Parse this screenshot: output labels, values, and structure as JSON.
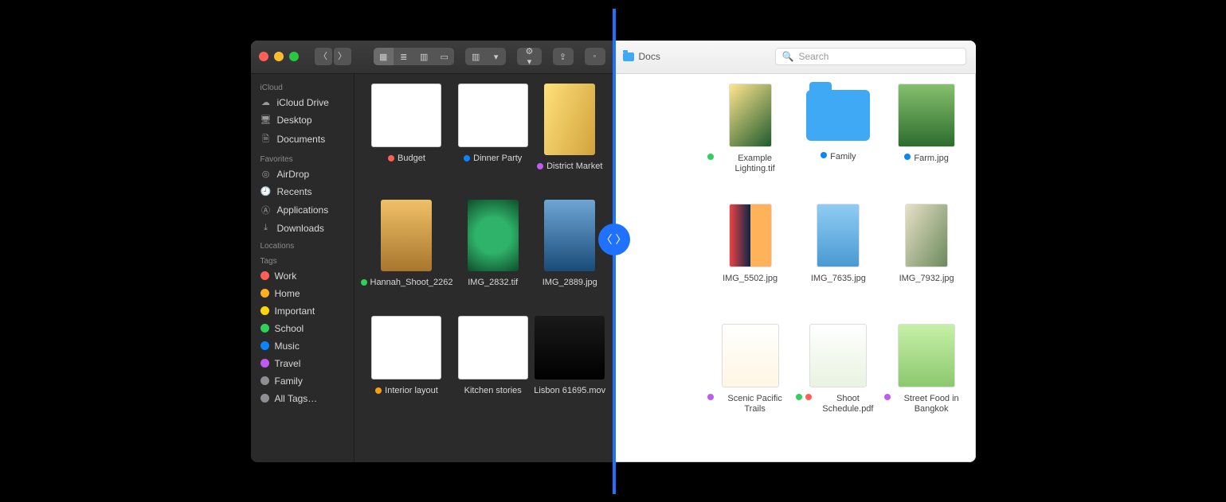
{
  "split": {
    "light_title": "Docs",
    "search_placeholder": "Search"
  },
  "sidebar": {
    "sections": [
      {
        "label": "iCloud",
        "items": [
          {
            "icon": "cloud-icon",
            "label": "iCloud Drive"
          },
          {
            "icon": "desktop-icon",
            "label": "Desktop"
          },
          {
            "icon": "documents-icon",
            "label": "Documents"
          }
        ]
      },
      {
        "label": "Favorites",
        "items": [
          {
            "icon": "airdrop-icon",
            "label": "AirDrop"
          },
          {
            "icon": "recents-icon",
            "label": "Recents"
          },
          {
            "icon": "applications-icon",
            "label": "Applications"
          },
          {
            "icon": "downloads-icon",
            "label": "Downloads"
          }
        ]
      },
      {
        "label": "Locations",
        "items": []
      },
      {
        "label": "Tags",
        "items": [
          {
            "color": "#ff5f57",
            "label": "Work"
          },
          {
            "color": "#ffb01f",
            "label": "Home"
          },
          {
            "color": "#ffd60a",
            "label": "Important"
          },
          {
            "color": "#30d158",
            "label": "School"
          },
          {
            "color": "#0a84ff",
            "label": "Music"
          },
          {
            "color": "#bf5af2",
            "label": "Travel"
          },
          {
            "color": "#8e8e93",
            "label": "Family"
          },
          {
            "color": "#8e8e93",
            "label": "All Tags…"
          }
        ]
      }
    ]
  },
  "dark_files": [
    {
      "tag": "#ff5f57",
      "label": "Budget"
    },
    {
      "tag": "#0a84ff",
      "label": "Dinner Party"
    },
    {
      "tag": "#bf5af2",
      "label": "District Market"
    },
    {
      "tag": "#30d158",
      "label": "Hannah_Shoot_2262"
    },
    {
      "tag": null,
      "label": "IMG_2832.tif"
    },
    {
      "tag": null,
      "label": "IMG_2889.jpg"
    },
    {
      "tag": "#ff9f0a",
      "label": "Interior layout"
    },
    {
      "tag": null,
      "label": "Kitchen stories"
    },
    {
      "tag": null,
      "label": "Lisbon 61695.mov"
    }
  ],
  "light_files": [
    {
      "tag": "#30d158",
      "label": "Example Lighting.tif"
    },
    {
      "tag": "#0a84ff",
      "label": "Family",
      "folder": true
    },
    {
      "tag": "#0a84ff",
      "label": "Farm.jpg"
    },
    {
      "tag": null,
      "label": "IMG_5502.jpg"
    },
    {
      "tag": null,
      "label": "IMG_7635.jpg"
    },
    {
      "tag": null,
      "label": "IMG_7932.jpg"
    },
    {
      "tag": "#bf5af2",
      "label": "Scenic Pacific Trails"
    },
    {
      "tag": "#30d158;#ff5f57",
      "label": "Shoot Schedule.pdf"
    },
    {
      "tag": "#bf5af2",
      "label": "Street Food in Bangkok"
    }
  ]
}
